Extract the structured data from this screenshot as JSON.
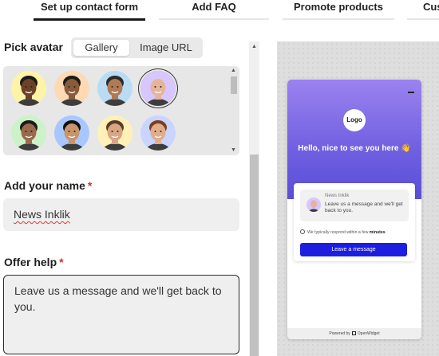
{
  "tabs": [
    {
      "label": "Set up contact form",
      "active": true
    },
    {
      "label": "Add FAQ",
      "active": false
    },
    {
      "label": "Promote products",
      "active": false
    },
    {
      "label": "Cus",
      "active": false
    }
  ],
  "form": {
    "avatar_section": {
      "title": "Pick avatar",
      "options": [
        "Gallery",
        "Image URL"
      ],
      "selected_option": "Gallery",
      "avatars": [
        {
          "skin": "#6b4226",
          "bg": "#fff3a6",
          "hair": "#1b1b1b"
        },
        {
          "skin": "#8a5a3b",
          "bg": "#ffd9b3",
          "hair": "#1b1b1b"
        },
        {
          "skin": "#b07a55",
          "bg": "#b9dcf5",
          "hair": "#2b2b2b"
        },
        {
          "skin": "#e6b49a",
          "bg": "#d8c6ff",
          "hair": "#e6b49a",
          "selected": true
        },
        {
          "skin": "#9a6a4a",
          "bg": "#ccf2c8",
          "hair": "#1b1b1b"
        },
        {
          "skin": "#c8946a",
          "bg": "#a9c7ff",
          "hair": "#111111"
        },
        {
          "skin": "#d9a583",
          "bg": "#fff0b8",
          "hair": "#5a3a25"
        },
        {
          "skin": "#e2ad8a",
          "bg": "#c9d4ff",
          "hair": "#7a3f20"
        }
      ]
    },
    "name_field": {
      "label": "Add your name",
      "required_mark": "*",
      "value": "News Inklik"
    },
    "help_field": {
      "label": "Offer help",
      "required_mark": "*",
      "value": "Leave us a message and we'll get back to you."
    }
  },
  "preview": {
    "logo_text": "Logo",
    "greeting": "Hello, nice to see you here 👋",
    "sender": "News Inklik",
    "message": "Leave us a message and we'll get back to you.",
    "response_prefix": "We typically respond within a few ",
    "response_bold": "minutes",
    "response_suffix": ".",
    "button_label": "Leave a message",
    "footer_prefix": "Powered by",
    "footer_brand": "OpenWidget"
  },
  "colors": {
    "accent": "#1e1ee0",
    "header_top": "#9b82f0",
    "header_bottom": "#5a4fd8",
    "required": "#d32f2f"
  }
}
